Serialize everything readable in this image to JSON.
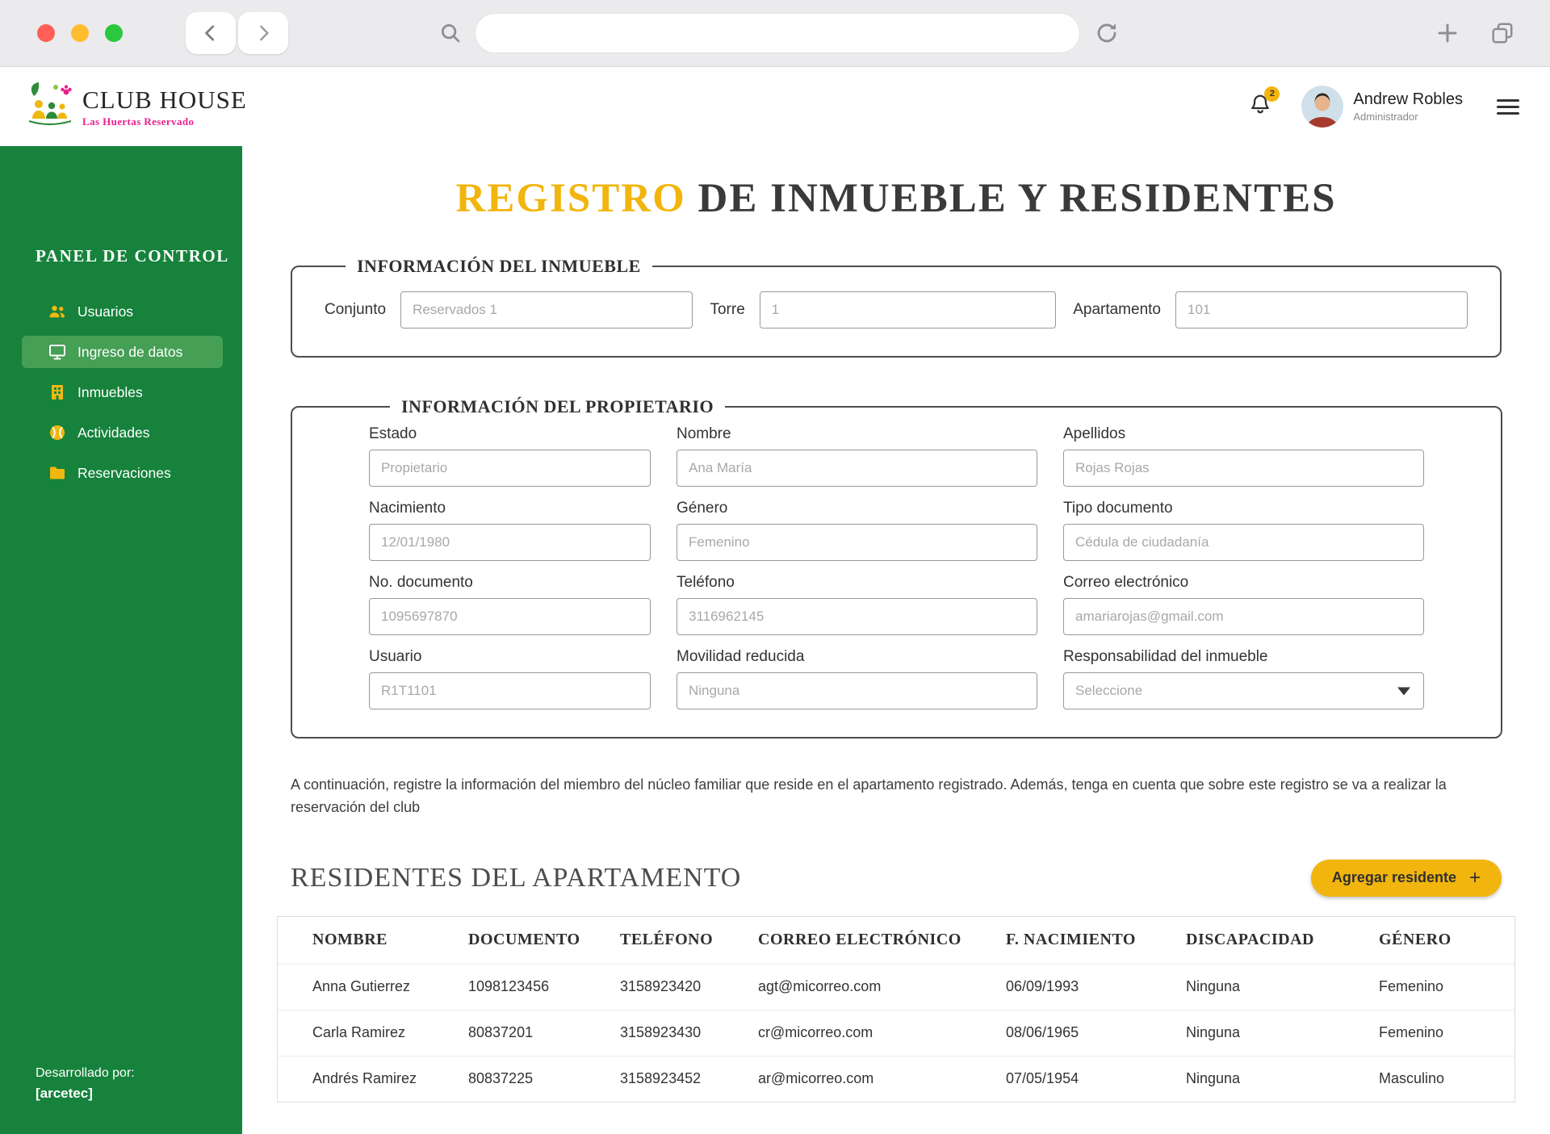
{
  "header": {
    "brand": {
      "title": "CLUB HOUSE",
      "subtitle": "Las Huertas Reservado"
    },
    "notifications_count": "2",
    "user": {
      "name": "Andrew Robles",
      "role": "Administrador"
    }
  },
  "sidebar": {
    "title": "PANEL DE CONTROL",
    "items": [
      {
        "label": "Usuarios"
      },
      {
        "label": "Ingreso de datos"
      },
      {
        "label": "Inmuebles"
      },
      {
        "label": "Actividades"
      },
      {
        "label": "Reservaciones"
      }
    ],
    "footer": {
      "line1": "Desarrollado por:",
      "line2": "[arcetec]"
    }
  },
  "page": {
    "title_accent": "REGISTRO",
    "title_rest": " DE INMUEBLE Y RESIDENTES"
  },
  "inmueble_section": {
    "legend": "INFORMACIÓN DEL INMUEBLE",
    "fields": [
      {
        "label": "Conjunto",
        "placeholder": "Reservados 1"
      },
      {
        "label": "Torre",
        "placeholder": "1"
      },
      {
        "label": "Apartamento",
        "placeholder": "101"
      }
    ]
  },
  "propietario_section": {
    "legend": "INFORMACIÓN DEL PROPIETARIO",
    "fields": [
      {
        "label": "Estado",
        "placeholder": "Propietario"
      },
      {
        "label": "Nombre",
        "placeholder": "Ana María"
      },
      {
        "label": "Apellidos",
        "placeholder": "Rojas Rojas"
      },
      {
        "label": "Nacimiento",
        "placeholder": "12/01/1980"
      },
      {
        "label": "Género",
        "placeholder": "Femenino"
      },
      {
        "label": "Tipo documento",
        "placeholder": "Cédula de ciudadanía"
      },
      {
        "label": "No. documento",
        "placeholder": "1095697870"
      },
      {
        "label": "Teléfono",
        "placeholder": "3116962145"
      },
      {
        "label": "Correo electrónico",
        "placeholder": "amariarojas@gmail.com"
      },
      {
        "label": "Usuario",
        "placeholder": "R1T1101"
      },
      {
        "label": "Movilidad reducida",
        "placeholder": "Ninguna"
      },
      {
        "label": "Responsabilidad del inmueble",
        "placeholder": "Seleccione"
      }
    ]
  },
  "note": "A continuación, registre la información del miembro del núcleo familiar que reside en el apartamento registrado. Además, tenga en cuenta que sobre este registro se va a realizar la reservación del club",
  "residents_section": {
    "title": "RESIDENTES DEL APARTAMENTO",
    "add_button": "Agregar residente",
    "add_icon": "+",
    "table": {
      "headers": [
        "NOMBRE",
        "DOCUMENTO",
        "TELÉFONO",
        "CORREO ELECTRÓNICO",
        "F. NACIMIENTO",
        "DISCAPACIDAD",
        "GÉNERO"
      ],
      "rows": [
        [
          "Anna Gutierrez",
          "1098123456",
          "3158923420",
          "agt@micorreo.com",
          "06/09/1993",
          "Ninguna",
          "Femenino"
        ],
        [
          "Carla Ramirez",
          "80837201",
          "3158923430",
          "cr@micorreo.com",
          "08/06/1965",
          "Ninguna",
          "Femenino"
        ],
        [
          "Andrés Ramirez",
          "80837225",
          "3158923452",
          "ar@micorreo.com",
          "07/05/1954",
          "Ninguna",
          "Masculino"
        ]
      ]
    }
  },
  "colors": {
    "accent_yellow": "#F2B50D",
    "sidebar_green": "#16823C",
    "brand_pink": "#E8218F"
  }
}
